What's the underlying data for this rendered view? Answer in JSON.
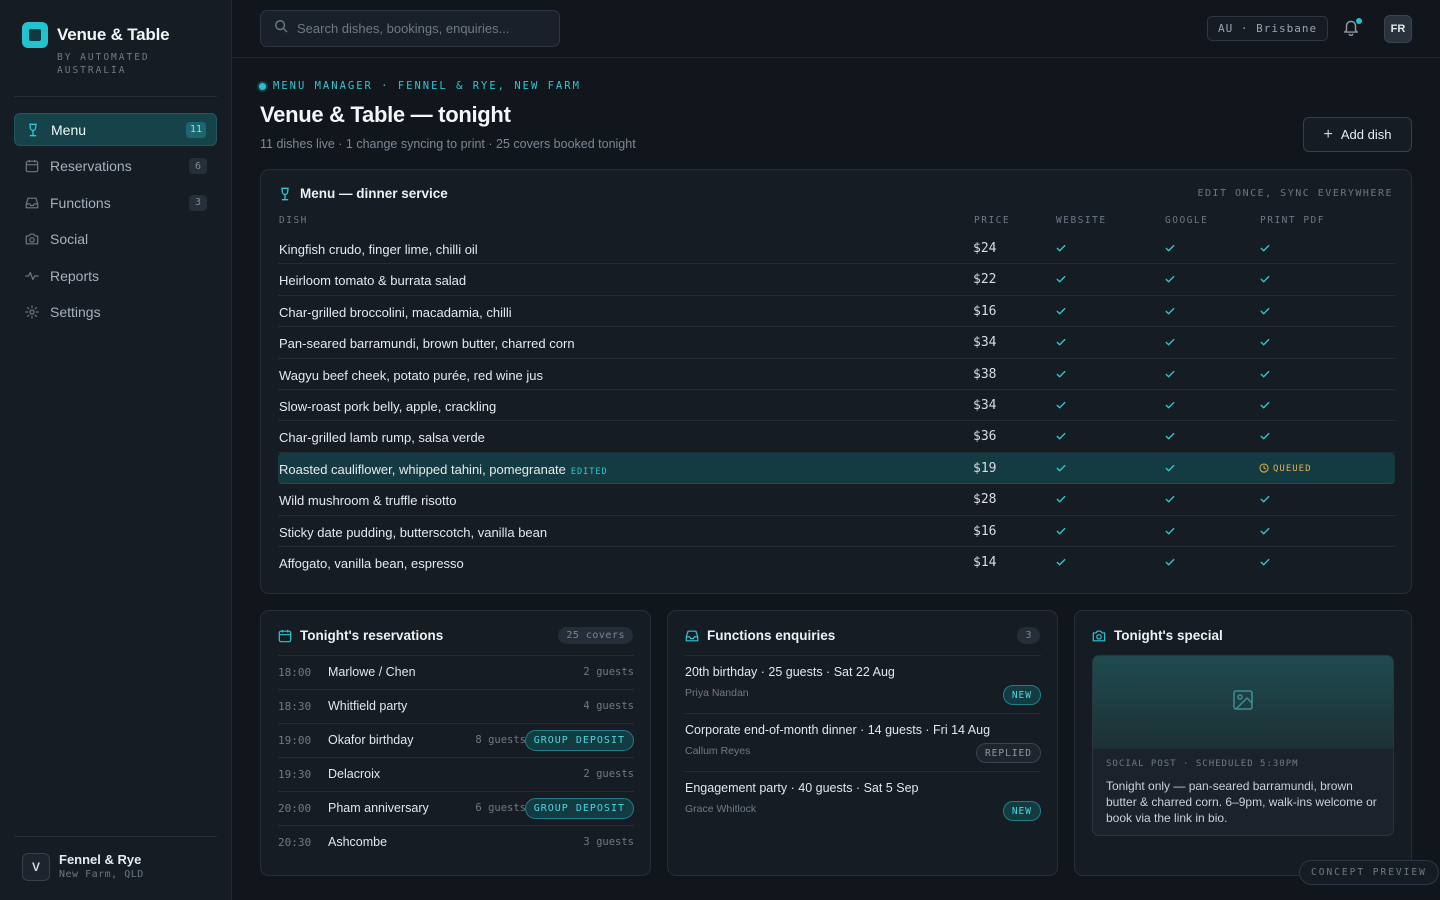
{
  "brand": {
    "name": "Venue & Table",
    "tagline": "BY AUTOMATED AUSTRALIA",
    "accent": "#22c3cf"
  },
  "sidebar": {
    "items": [
      {
        "label": "Menu",
        "icon": "wine-glass-icon",
        "count": "11",
        "active": true
      },
      {
        "label": "Reservations",
        "icon": "calendar-icon",
        "count": "6"
      },
      {
        "label": "Functions",
        "icon": "inbox-icon",
        "count": "3"
      },
      {
        "label": "Social",
        "icon": "camera-icon"
      },
      {
        "label": "Reports",
        "icon": "activity-icon"
      },
      {
        "label": "Settings",
        "icon": "gear-icon"
      }
    ],
    "profile": {
      "initial": "V",
      "name": "Fennel & Rye",
      "location": "New Farm, QLD"
    }
  },
  "topbar": {
    "search_placeholder": "Search dishes, bookings, enquiries...",
    "region": "AU · Brisbane",
    "user_initials": "FR"
  },
  "header": {
    "eyebrow": "MENU MANAGER · FENNEL & RYE, NEW FARM",
    "title": "Venue & Table — tonight",
    "subtitle": "11 dishes live · 1 change syncing to print · 25 covers booked tonight",
    "add_label": "Add dish"
  },
  "menu": {
    "title": "Menu — dinner service",
    "sync_note": "EDIT ONCE, SYNC EVERYWHERE",
    "columns": [
      "DISH",
      "PRICE",
      "WEBSITE",
      "GOOGLE",
      "PRINT PDF"
    ],
    "rows": [
      {
        "dish": "Kingfish crudo, finger lime, chilli oil",
        "price": "$24",
        "print": "synced"
      },
      {
        "dish": "Heirloom tomato & burrata salad",
        "price": "$22",
        "print": "synced"
      },
      {
        "dish": "Char-grilled broccolini, macadamia, chilli",
        "price": "$16",
        "print": "synced"
      },
      {
        "dish": "Pan-seared barramundi, brown butter, charred corn",
        "price": "$34",
        "print": "synced"
      },
      {
        "dish": "Wagyu beef cheek, potato purée, red wine jus",
        "price": "$38",
        "print": "synced"
      },
      {
        "dish": "Slow-roast pork belly, apple, crackling",
        "price": "$34",
        "print": "synced"
      },
      {
        "dish": "Char-grilled lamb rump, salsa verde",
        "price": "$36",
        "print": "synced"
      },
      {
        "dish": "Roasted cauliflower, whipped tahini, pomegranate",
        "price": "$19",
        "print": "queued",
        "tag": "EDITED",
        "print_label": "QUEUED"
      },
      {
        "dish": "Wild mushroom & truffle risotto",
        "price": "$28",
        "print": "synced"
      },
      {
        "dish": "Sticky date pudding, butterscotch, vanilla bean",
        "price": "$16",
        "print": "synced"
      },
      {
        "dish": "Affogato, vanilla bean, espresso",
        "price": "$14",
        "print": "synced"
      }
    ]
  },
  "reservations": {
    "title": "Tonight's reservations",
    "count": "25 covers",
    "rows": [
      {
        "time": "18:00",
        "name": "Marlowe / Chen",
        "guests": "2 guests"
      },
      {
        "time": "18:30",
        "name": "Whitfield party",
        "guests": "4 guests"
      },
      {
        "time": "19:00",
        "name": "Okafor birthday",
        "guests": "8 guests",
        "badge": "GROUP DEPOSIT"
      },
      {
        "time": "19:30",
        "name": "Delacroix",
        "guests": "2 guests"
      },
      {
        "time": "20:00",
        "name": "Pham anniversary",
        "guests": "6 guests",
        "badge": "GROUP DEPOSIT"
      },
      {
        "time": "20:30",
        "name": "Ashcombe",
        "guests": "3 guests"
      }
    ]
  },
  "functions": {
    "title": "Functions enquiries",
    "count": "3",
    "rows": [
      {
        "title": "20th birthday · 25 guests · Sat 22 Aug",
        "name": "Priya Nandan",
        "status": "NEW"
      },
      {
        "title": "Corporate end-of-month dinner · 14 guests · Fri 14 Aug",
        "name": "Callum Reyes",
        "status": "REPLIED"
      },
      {
        "title": "Engagement party · 40 guests · Sat 5 Sep",
        "name": "Grace Whitlock",
        "status": "NEW"
      }
    ]
  },
  "special": {
    "title": "Tonight's special",
    "meta": "SOCIAL POST · SCHEDULED 5:30PM",
    "text": "Tonight only — pan-seared barramundi, brown butter & charred corn. 6–9pm, walk-ins welcome or book via the link in bio."
  },
  "concept_label": "CONCEPT PREVIEW"
}
